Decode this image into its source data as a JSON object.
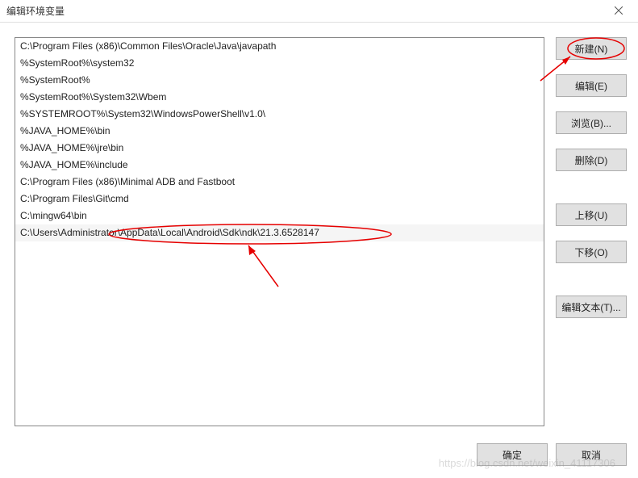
{
  "window": {
    "title": "编辑环境变量"
  },
  "paths": [
    "C:\\Program Files (x86)\\Common Files\\Oracle\\Java\\javapath",
    "%SystemRoot%\\system32",
    "%SystemRoot%",
    "%SystemRoot%\\System32\\Wbem",
    "%SYSTEMROOT%\\System32\\WindowsPowerShell\\v1.0\\",
    "%JAVA_HOME%\\bin",
    "%JAVA_HOME%\\jre\\bin",
    "%JAVA_HOME%\\include",
    "C:\\Program Files (x86)\\Minimal ADB and Fastboot",
    "C:\\Program Files\\Git\\cmd",
    "C:\\mingw64\\bin",
    "C:\\Users\\Administrator\\AppData\\Local\\Android\\Sdk\\ndk\\21.3.6528147"
  ],
  "editing_index": 11,
  "buttons": {
    "new": "新建(N)",
    "edit": "编辑(E)",
    "browse": "浏览(B)...",
    "delete": "删除(D)",
    "move_up": "上移(U)",
    "move_down": "下移(O)",
    "edit_text": "编辑文本(T)...",
    "ok": "确定",
    "cancel": "取消"
  },
  "watermark": "https://blog.csdn.net/weixin_41117306",
  "annotation": {
    "highlight_button": "new",
    "highlight_row": 11
  }
}
